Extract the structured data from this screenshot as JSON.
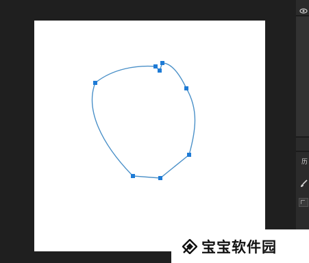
{
  "panel": {
    "history_label": "历",
    "icons": [
      "eye-icon",
      "brush-icon",
      "layer-thumbnail"
    ]
  },
  "canvas": {
    "background": "#ffffff",
    "workspace_color": "#1f1f1f",
    "path_color": "#4a90c8",
    "anchor_color": "#1e7bd6"
  },
  "watermark": {
    "text": "宝宝软件园"
  }
}
